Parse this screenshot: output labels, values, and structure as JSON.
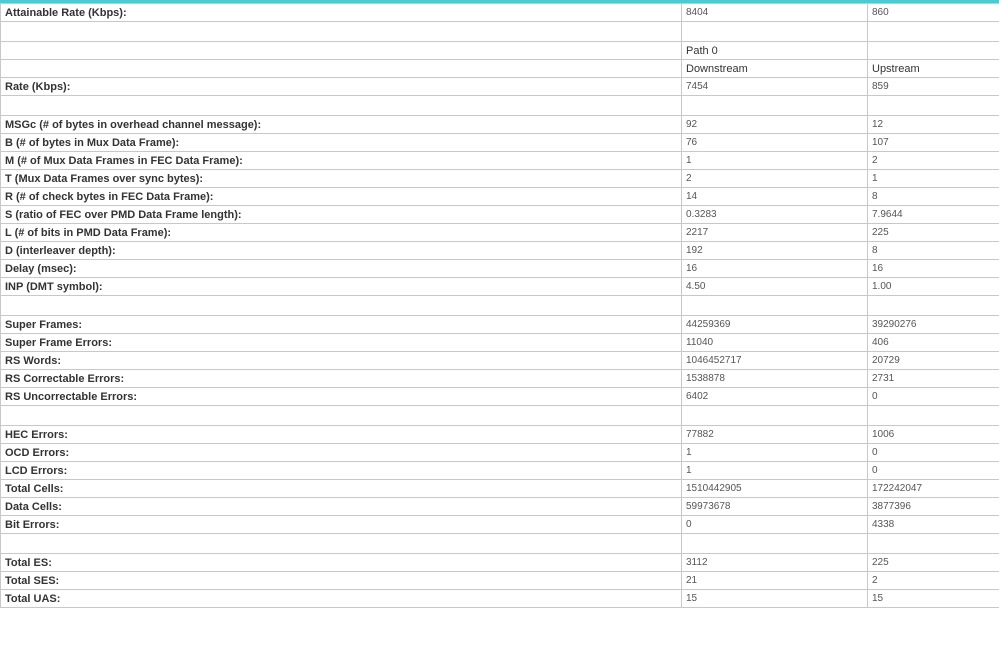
{
  "colors": {
    "accent_bar": "#4ec9d2",
    "grid_border": "#c8c8c8",
    "label_text": "#333333",
    "value_text": "#555555"
  },
  "header": {
    "path": "Path 0",
    "downstream": "Downstream",
    "upstream": "Upstream"
  },
  "rows": {
    "attainable_rate": {
      "label": "Attainable Rate (Kbps):",
      "down": "8404",
      "up": "860"
    },
    "rate": {
      "label": "Rate (Kbps):",
      "down": "7454",
      "up": "859"
    },
    "msgc": {
      "label": "MSGc (# of bytes in overhead channel message):",
      "down": "92",
      "up": "12"
    },
    "b": {
      "label": "B (# of bytes in Mux Data Frame):",
      "down": "76",
      "up": "107"
    },
    "m": {
      "label": "M (# of Mux Data Frames in FEC Data Frame):",
      "down": "1",
      "up": "2"
    },
    "t": {
      "label": "T (Mux Data Frames over sync bytes):",
      "down": "2",
      "up": "1"
    },
    "r": {
      "label": "R (# of check bytes in FEC Data Frame):",
      "down": "14",
      "up": "8"
    },
    "s": {
      "label": "S (ratio of FEC over PMD Data Frame length):",
      "down": "0.3283",
      "up": "7.9644"
    },
    "l": {
      "label": "L (# of bits in PMD Data Frame):",
      "down": "2217",
      "up": "225"
    },
    "d": {
      "label": "D (interleaver depth):",
      "down": "192",
      "up": "8"
    },
    "delay": {
      "label": "Delay (msec):",
      "down": "16",
      "up": "16"
    },
    "inp": {
      "label": "INP (DMT symbol):",
      "down": "4.50",
      "up": "1.00"
    },
    "super_frames": {
      "label": "Super Frames:",
      "down": "44259369",
      "up": "39290276"
    },
    "super_frame_errors": {
      "label": "Super Frame Errors:",
      "down": "11040",
      "up": "406"
    },
    "rs_words": {
      "label": "RS Words:",
      "down": "1046452717",
      "up": "20729"
    },
    "rs_correctable": {
      "label": "RS Correctable Errors:",
      "down": "1538878",
      "up": "2731"
    },
    "rs_uncorrectable": {
      "label": "RS Uncorrectable Errors:",
      "down": "6402",
      "up": "0"
    },
    "hec_errors": {
      "label": "HEC Errors:",
      "down": "77882",
      "up": "1006"
    },
    "ocd_errors": {
      "label": "OCD Errors:",
      "down": "1",
      "up": "0"
    },
    "lcd_errors": {
      "label": "LCD Errors:",
      "down": "1",
      "up": "0"
    },
    "total_cells": {
      "label": "Total Cells:",
      "down": "1510442905",
      "up": "172242047"
    },
    "data_cells": {
      "label": "Data Cells:",
      "down": "59973678",
      "up": "3877396"
    },
    "bit_errors": {
      "label": "Bit Errors:",
      "down": "0",
      "up": "4338"
    },
    "total_es": {
      "label": "Total ES:",
      "down": "3112",
      "up": "225"
    },
    "total_ses": {
      "label": "Total SES:",
      "down": "21",
      "up": "2"
    },
    "total_uas": {
      "label": "Total UAS:",
      "down": "15",
      "up": "15"
    }
  }
}
